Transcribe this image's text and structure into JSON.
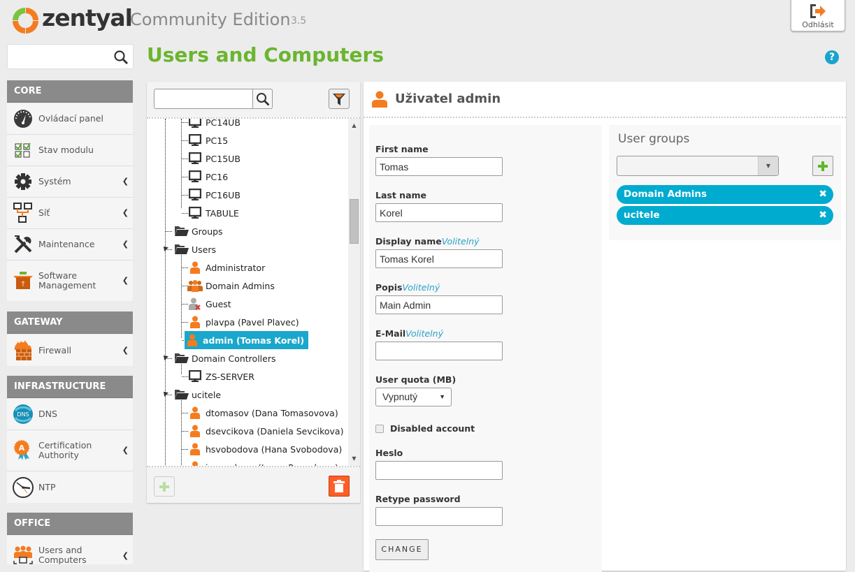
{
  "header": {
    "brand": "zentyal",
    "edition": "Community Edition",
    "version": "3.5",
    "logout_label": "Odhlásit",
    "help_label": "?"
  },
  "sidebar": {
    "search_placeholder": "",
    "sections": [
      {
        "title": "CORE",
        "items": [
          {
            "label": "Ovládací panel",
            "icon": "dashboard-icon",
            "has_submenu": false
          },
          {
            "label": "Stav modulu",
            "icon": "module-status-icon",
            "has_submenu": false
          },
          {
            "label": "Systém",
            "icon": "gear-icon",
            "has_submenu": true
          },
          {
            "label": "Síť",
            "icon": "network-icon",
            "has_submenu": true
          },
          {
            "label": "Maintenance",
            "icon": "tools-icon",
            "has_submenu": true
          },
          {
            "label": "Software Management",
            "icon": "package-icon",
            "has_submenu": true
          }
        ]
      },
      {
        "title": "GATEWAY",
        "items": [
          {
            "label": "Firewall",
            "icon": "firewall-icon",
            "has_submenu": true
          }
        ]
      },
      {
        "title": "INFRASTRUCTURE",
        "items": [
          {
            "label": "DNS",
            "icon": "dns-icon",
            "has_submenu": false
          },
          {
            "label": "Certification Authority",
            "icon": "certificate-icon",
            "has_submenu": true
          },
          {
            "label": "NTP",
            "icon": "clock-icon",
            "has_submenu": false
          }
        ]
      },
      {
        "title": "OFFICE",
        "items": [
          {
            "label": "Users and Computers",
            "icon": "users-computers-icon",
            "has_submenu": true
          }
        ]
      }
    ]
  },
  "page": {
    "title": "Users and Computers"
  },
  "tree": {
    "search_value": "",
    "nodes": [
      {
        "label": "PC14UB",
        "type": "computer"
      },
      {
        "label": "PC15",
        "type": "computer"
      },
      {
        "label": "PC15UB",
        "type": "computer"
      },
      {
        "label": "PC16",
        "type": "computer"
      },
      {
        "label": "PC16UB",
        "type": "computer"
      },
      {
        "label": "TABULE",
        "type": "computer"
      },
      {
        "label": "Groups",
        "type": "folder"
      },
      {
        "label": "Users",
        "type": "folder"
      },
      {
        "label": "Administrator",
        "type": "user"
      },
      {
        "label": "Domain Admins",
        "type": "group"
      },
      {
        "label": "Guest",
        "type": "user-disabled"
      },
      {
        "label": "plavpa (Pavel Plavec)",
        "type": "user"
      },
      {
        "label": "admin (Tomas Korel)",
        "type": "user",
        "selected": true
      },
      {
        "label": "Domain Controllers",
        "type": "folder"
      },
      {
        "label": "ZS-SERVER",
        "type": "computer"
      },
      {
        "label": "ucitele",
        "type": "folder"
      },
      {
        "label": "dtomasov (Dana Tomasovova)",
        "type": "user"
      },
      {
        "label": "dsevcikova (Daniela Sevcikova)",
        "type": "user"
      },
      {
        "label": "hsvobodova (Hana Svobodova)",
        "type": "user"
      },
      {
        "label": "ipecenkova (Ivana Pecenkova)",
        "type": "user"
      }
    ]
  },
  "detail": {
    "title": "Uživatel admin",
    "optional_label": "Volitelný",
    "fields": {
      "first_name": {
        "label": "First name",
        "value": "Tomas"
      },
      "last_name": {
        "label": "Last name",
        "value": "Korel"
      },
      "display_name": {
        "label": "Display name",
        "value": "Tomas Korel"
      },
      "description": {
        "label": "Popis",
        "value": "Main Admin"
      },
      "email": {
        "label": "E-Mail",
        "value": ""
      },
      "quota": {
        "label": "User quota (MB)",
        "value": "Vypnutý"
      },
      "disabled": {
        "label": "Disabled account",
        "checked": false
      },
      "password": {
        "label": "Heslo",
        "value": ""
      },
      "retype": {
        "label": "Retype password",
        "value": ""
      }
    },
    "change_label": "CHANGE",
    "groups": {
      "title": "User groups",
      "select_value": "",
      "items": [
        "Domain Admins",
        "ucitele"
      ]
    }
  },
  "colors": {
    "accent_green": "#6bb52f",
    "accent_orange": "#f47c20",
    "selection_blue": "#1aa7cc",
    "tag_blue": "#00abd0",
    "delete_red": "#fe5e27"
  }
}
